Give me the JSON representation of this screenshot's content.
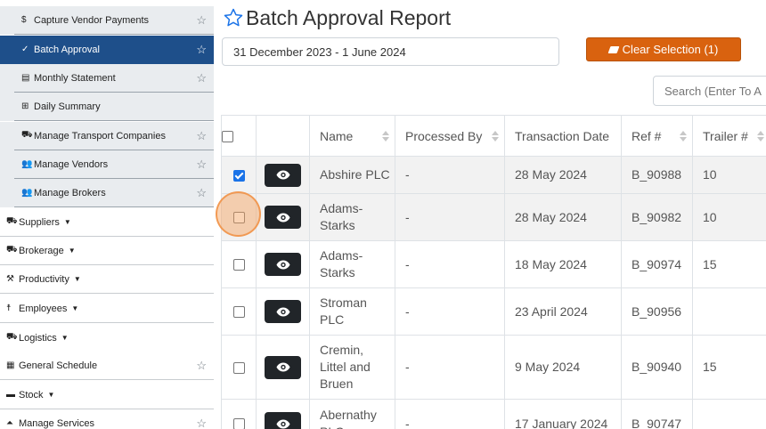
{
  "sidebar": {
    "sub_items": [
      {
        "label": "Capture Vendor Payments",
        "icon": "dollar-icon",
        "glyph": "$",
        "starred": true,
        "active": false
      },
      {
        "label": "Batch Approval",
        "icon": "check-icon",
        "glyph": "✓",
        "starred": true,
        "active": true
      },
      {
        "label": "Monthly Statement",
        "icon": "list-alt-icon",
        "glyph": "▤",
        "starred": true,
        "active": false
      },
      {
        "label": "Daily Summary",
        "icon": "table-icon",
        "glyph": "⊞",
        "starred": false,
        "active": false
      },
      {
        "label": "Manage Transport Companies",
        "icon": "truck-icon",
        "glyph": "⛟",
        "starred": true,
        "active": false
      },
      {
        "label": "Manage Vendors",
        "icon": "users-icon",
        "glyph": "👥",
        "starred": true,
        "active": false
      },
      {
        "label": "Manage Brokers",
        "icon": "users-icon",
        "glyph": "👥",
        "starred": true,
        "active": false
      }
    ],
    "top_items": [
      {
        "label": "Suppliers",
        "icon": "truck-loading-icon",
        "glyph": "⛟",
        "caret": true,
        "starred": false
      },
      {
        "label": "Brokerage",
        "icon": "truck-icon",
        "glyph": "⛟",
        "caret": true,
        "starred": false
      },
      {
        "label": "Productivity",
        "icon": "hammer-icon",
        "glyph": "⚒",
        "caret": true,
        "starred": false
      },
      {
        "label": "Employees",
        "icon": "person-icon",
        "glyph": "☨",
        "caret": true,
        "starred": false
      },
      {
        "label": "Logistics",
        "icon": "truck-icon",
        "glyph": "⛟",
        "caret": true,
        "starred": false
      },
      {
        "label": "General Schedule",
        "icon": "calendar-icon",
        "glyph": "▦",
        "caret": false,
        "starred": true
      },
      {
        "label": "Stock",
        "icon": "pallet-icon",
        "glyph": "▬",
        "caret": true,
        "starred": false
      },
      {
        "label": "Manage Services",
        "icon": "ship-icon",
        "glyph": "⏶",
        "caret": false,
        "starred": true
      }
    ]
  },
  "page": {
    "title": "Batch Approval Report",
    "date_range": "31 December 2023 - 1 June 2024",
    "clear_selection_label": "Clear Selection (1)",
    "search_placeholder": "Search (Enter To A"
  },
  "table": {
    "columns": [
      "Name",
      "Processed By",
      "Transaction Date",
      "Ref #",
      "Trailer #"
    ],
    "rows": [
      {
        "checked": true,
        "name": [
          "Abshire PLC"
        ],
        "processed_by": "-",
        "date": "28 May 2024",
        "ref": "B_90988",
        "trailer": "10"
      },
      {
        "checked": false,
        "name": [
          "Adams-",
          "Starks"
        ],
        "processed_by": "-",
        "date": "28 May 2024",
        "ref": "B_90982",
        "trailer": "10"
      },
      {
        "checked": false,
        "name": [
          "Adams-",
          "Starks"
        ],
        "processed_by": "-",
        "date": "18 May 2024",
        "ref": "B_90974",
        "trailer": "15"
      },
      {
        "checked": false,
        "name": [
          "Stroman",
          "PLC"
        ],
        "processed_by": "-",
        "date": "23 April 2024",
        "ref": "B_90956",
        "trailer": ""
      },
      {
        "checked": false,
        "name": [
          "Cremin,",
          "Littel and",
          "Bruen"
        ],
        "processed_by": "-",
        "date": "9 May 2024",
        "ref": "B_90940",
        "trailer": "15"
      },
      {
        "checked": false,
        "name": [
          "Abernathy",
          "PLC"
        ],
        "processed_by": "-",
        "date": "17 January 2024",
        "ref": "B_90747",
        "trailer": ""
      }
    ]
  },
  "colors": {
    "active_nav": "#1e4f8a",
    "clear_button": "#d9620f",
    "checkbox_checked": "#1a73e8",
    "eye_button": "#212529",
    "title_star": "#1a73e8"
  }
}
